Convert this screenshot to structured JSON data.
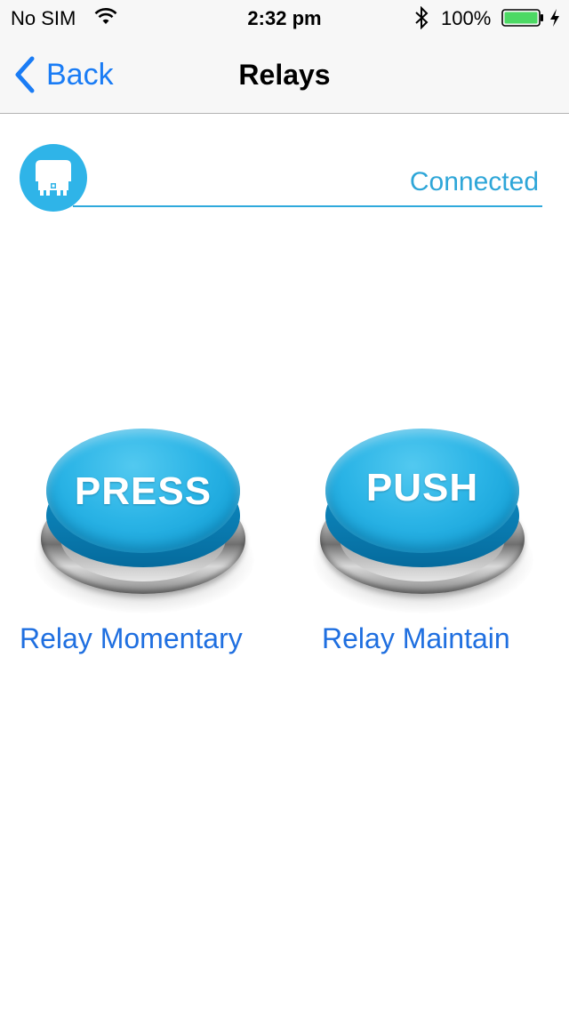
{
  "status_bar": {
    "carrier": "No SIM",
    "time": "2:32 pm",
    "battery_percent": "100%",
    "icons": [
      "wifi-icon",
      "bluetooth-icon",
      "battery-icon",
      "charging-icon"
    ]
  },
  "nav": {
    "back_label": "Back",
    "title": "Relays"
  },
  "device": {
    "icon": "relay-device-icon",
    "status": "Connected"
  },
  "buttons": [
    {
      "label": "PRESS",
      "caption": "Relay Momentary"
    },
    {
      "label": "PUSH",
      "caption": "Relay Maintain"
    }
  ],
  "colors": {
    "accent": "#1a7cf5",
    "button_blue": "#2bb4e6",
    "connected_text": "#2ea6d8"
  }
}
